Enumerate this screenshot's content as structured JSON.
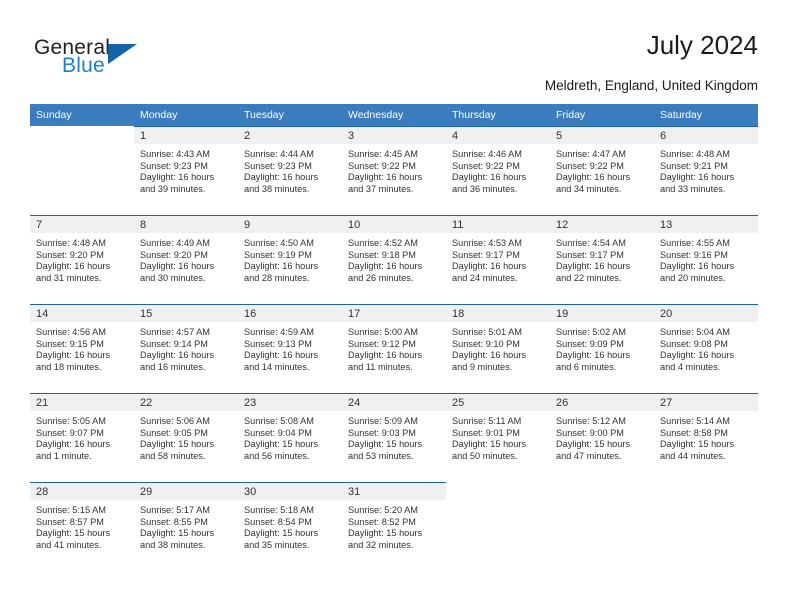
{
  "brand": {
    "name_part1": "General",
    "name_part2": "Blue",
    "accent_color": "#1f7fc4",
    "triangle_color": "#1464a5"
  },
  "header": {
    "title": "July 2024",
    "subtitle": "Meldreth, England, United Kingdom"
  },
  "theme": {
    "header_row_bg": "#3a7cbe",
    "daynum_band_bg": "#f0f0f0",
    "cell_top_border": "#1c64a5"
  },
  "weekday_headers": [
    "Sunday",
    "Monday",
    "Tuesday",
    "Wednesday",
    "Thursday",
    "Friday",
    "Saturday"
  ],
  "weeks": [
    [
      {
        "empty": true
      },
      {
        "day": "1",
        "sunrise": "Sunrise: 4:43 AM",
        "sunset": "Sunset: 9:23 PM",
        "daylight1": "Daylight: 16 hours",
        "daylight2": "and 39 minutes."
      },
      {
        "day": "2",
        "sunrise": "Sunrise: 4:44 AM",
        "sunset": "Sunset: 9:23 PM",
        "daylight1": "Daylight: 16 hours",
        "daylight2": "and 38 minutes."
      },
      {
        "day": "3",
        "sunrise": "Sunrise: 4:45 AM",
        "sunset": "Sunset: 9:22 PM",
        "daylight1": "Daylight: 16 hours",
        "daylight2": "and 37 minutes."
      },
      {
        "day": "4",
        "sunrise": "Sunrise: 4:46 AM",
        "sunset": "Sunset: 9:22 PM",
        "daylight1": "Daylight: 16 hours",
        "daylight2": "and 36 minutes."
      },
      {
        "day": "5",
        "sunrise": "Sunrise: 4:47 AM",
        "sunset": "Sunset: 9:22 PM",
        "daylight1": "Daylight: 16 hours",
        "daylight2": "and 34 minutes."
      },
      {
        "day": "6",
        "sunrise": "Sunrise: 4:48 AM",
        "sunset": "Sunset: 9:21 PM",
        "daylight1": "Daylight: 16 hours",
        "daylight2": "and 33 minutes."
      }
    ],
    [
      {
        "day": "7",
        "sunrise": "Sunrise: 4:48 AM",
        "sunset": "Sunset: 9:20 PM",
        "daylight1": "Daylight: 16 hours",
        "daylight2": "and 31 minutes."
      },
      {
        "day": "8",
        "sunrise": "Sunrise: 4:49 AM",
        "sunset": "Sunset: 9:20 PM",
        "daylight1": "Daylight: 16 hours",
        "daylight2": "and 30 minutes."
      },
      {
        "day": "9",
        "sunrise": "Sunrise: 4:50 AM",
        "sunset": "Sunset: 9:19 PM",
        "daylight1": "Daylight: 16 hours",
        "daylight2": "and 28 minutes."
      },
      {
        "day": "10",
        "sunrise": "Sunrise: 4:52 AM",
        "sunset": "Sunset: 9:18 PM",
        "daylight1": "Daylight: 16 hours",
        "daylight2": "and 26 minutes."
      },
      {
        "day": "11",
        "sunrise": "Sunrise: 4:53 AM",
        "sunset": "Sunset: 9:17 PM",
        "daylight1": "Daylight: 16 hours",
        "daylight2": "and 24 minutes."
      },
      {
        "day": "12",
        "sunrise": "Sunrise: 4:54 AM",
        "sunset": "Sunset: 9:17 PM",
        "daylight1": "Daylight: 16 hours",
        "daylight2": "and 22 minutes."
      },
      {
        "day": "13",
        "sunrise": "Sunrise: 4:55 AM",
        "sunset": "Sunset: 9:16 PM",
        "daylight1": "Daylight: 16 hours",
        "daylight2": "and 20 minutes."
      }
    ],
    [
      {
        "day": "14",
        "sunrise": "Sunrise: 4:56 AM",
        "sunset": "Sunset: 9:15 PM",
        "daylight1": "Daylight: 16 hours",
        "daylight2": "and 18 minutes."
      },
      {
        "day": "15",
        "sunrise": "Sunrise: 4:57 AM",
        "sunset": "Sunset: 9:14 PM",
        "daylight1": "Daylight: 16 hours",
        "daylight2": "and 16 minutes."
      },
      {
        "day": "16",
        "sunrise": "Sunrise: 4:59 AM",
        "sunset": "Sunset: 9:13 PM",
        "daylight1": "Daylight: 16 hours",
        "daylight2": "and 14 minutes."
      },
      {
        "day": "17",
        "sunrise": "Sunrise: 5:00 AM",
        "sunset": "Sunset: 9:12 PM",
        "daylight1": "Daylight: 16 hours",
        "daylight2": "and 11 minutes."
      },
      {
        "day": "18",
        "sunrise": "Sunrise: 5:01 AM",
        "sunset": "Sunset: 9:10 PM",
        "daylight1": "Daylight: 16 hours",
        "daylight2": "and 9 minutes."
      },
      {
        "day": "19",
        "sunrise": "Sunrise: 5:02 AM",
        "sunset": "Sunset: 9:09 PM",
        "daylight1": "Daylight: 16 hours",
        "daylight2": "and 6 minutes."
      },
      {
        "day": "20",
        "sunrise": "Sunrise: 5:04 AM",
        "sunset": "Sunset: 9:08 PM",
        "daylight1": "Daylight: 16 hours",
        "daylight2": "and 4 minutes."
      }
    ],
    [
      {
        "day": "21",
        "sunrise": "Sunrise: 5:05 AM",
        "sunset": "Sunset: 9:07 PM",
        "daylight1": "Daylight: 16 hours",
        "daylight2": "and 1 minute."
      },
      {
        "day": "22",
        "sunrise": "Sunrise: 5:06 AM",
        "sunset": "Sunset: 9:05 PM",
        "daylight1": "Daylight: 15 hours",
        "daylight2": "and 58 minutes."
      },
      {
        "day": "23",
        "sunrise": "Sunrise: 5:08 AM",
        "sunset": "Sunset: 9:04 PM",
        "daylight1": "Daylight: 15 hours",
        "daylight2": "and 56 minutes."
      },
      {
        "day": "24",
        "sunrise": "Sunrise: 5:09 AM",
        "sunset": "Sunset: 9:03 PM",
        "daylight1": "Daylight: 15 hours",
        "daylight2": "and 53 minutes."
      },
      {
        "day": "25",
        "sunrise": "Sunrise: 5:11 AM",
        "sunset": "Sunset: 9:01 PM",
        "daylight1": "Daylight: 15 hours",
        "daylight2": "and 50 minutes."
      },
      {
        "day": "26",
        "sunrise": "Sunrise: 5:12 AM",
        "sunset": "Sunset: 9:00 PM",
        "daylight1": "Daylight: 15 hours",
        "daylight2": "and 47 minutes."
      },
      {
        "day": "27",
        "sunrise": "Sunrise: 5:14 AM",
        "sunset": "Sunset: 8:58 PM",
        "daylight1": "Daylight: 15 hours",
        "daylight2": "and 44 minutes."
      }
    ],
    [
      {
        "day": "28",
        "sunrise": "Sunrise: 5:15 AM",
        "sunset": "Sunset: 8:57 PM",
        "daylight1": "Daylight: 15 hours",
        "daylight2": "and 41 minutes."
      },
      {
        "day": "29",
        "sunrise": "Sunrise: 5:17 AM",
        "sunset": "Sunset: 8:55 PM",
        "daylight1": "Daylight: 15 hours",
        "daylight2": "and 38 minutes."
      },
      {
        "day": "30",
        "sunrise": "Sunrise: 5:18 AM",
        "sunset": "Sunset: 8:54 PM",
        "daylight1": "Daylight: 15 hours",
        "daylight2": "and 35 minutes."
      },
      {
        "day": "31",
        "sunrise": "Sunrise: 5:20 AM",
        "sunset": "Sunset: 8:52 PM",
        "daylight1": "Daylight: 15 hours",
        "daylight2": "and 32 minutes."
      },
      {
        "empty": true
      },
      {
        "empty": true
      },
      {
        "empty": true
      }
    ]
  ]
}
